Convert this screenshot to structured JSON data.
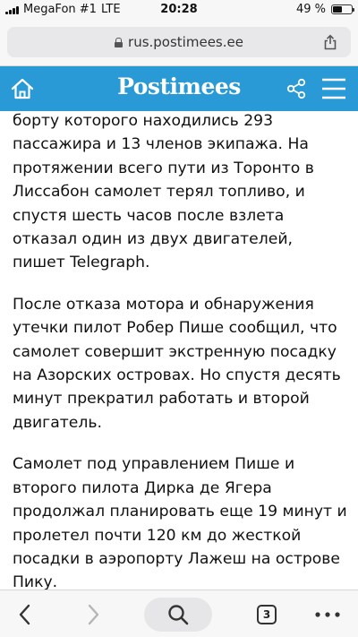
{
  "status_bar": {
    "carrier": "MegaFon #1",
    "network": "LTE",
    "time": "20:28",
    "battery_percent": "49 %",
    "battery_level": 0.49
  },
  "browser": {
    "url": "rus.postimees.ee",
    "open_tabs": "3"
  },
  "site": {
    "logo": "Postimees",
    "brand_color": "#2a9ad6"
  },
  "article": {
    "paragraphs": [
      "борту которого находились 293 пассажира и 13 членов экипажа. На протяжении всего пути из Торонто в Лиссабон самолет терял топливо, и спустя шесть часов после взлета отказал один из двух двигателей, пишет Telegraph.",
      "После отказа мотора и обнаружения утечки пилот Робер Пише сообщил, что самолет совершит экстренную посадку на Азорских островах. Но спустя десять минут прекратил работать и второй двигатель.",
      "Самолет под управлением Пише и второго пилота Дирка де Ягера продолжал планировать еще 19 минут и пролетел почти 120 км до жесткой посадки в аэропорту Лажеш на острове Пику."
    ]
  },
  "icons": {
    "home": "home-icon",
    "share": "share-icon",
    "social_share": "share-nodes-icon",
    "menu": "hamburger-menu-icon",
    "back": "chevron-left-icon",
    "forward": "chevron-right-icon",
    "search": "search-icon",
    "more": "ellipsis-icon"
  }
}
